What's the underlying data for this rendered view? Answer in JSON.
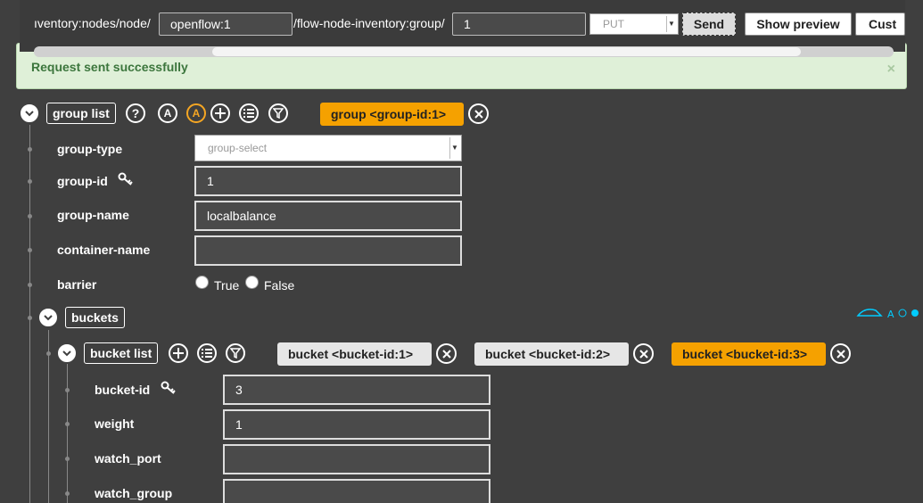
{
  "topbar": {
    "url_prefix": "ıventory:nodes/node/",
    "node_value": "openflow:1",
    "url_middle": "/flow-node-inventory:group/",
    "group_value": "1",
    "method": "PUT",
    "send_label": "Send",
    "preview_label": "Show preview",
    "custom_label": "Cust"
  },
  "alert": {
    "message": "Request sent successfully",
    "close": "×"
  },
  "group": {
    "list_label": "group list",
    "help_glyph": "?",
    "a_glyph": "A",
    "active_item": "group  <group-id:1>",
    "fields": {
      "group_type_label": "group-type",
      "group_type_value": "group-select",
      "group_id_label": "group-id",
      "group_id_value": "1",
      "group_name_label": "group-name",
      "group_name_value": "localbalance",
      "container_name_label": "container-name",
      "container_name_value": "",
      "barrier_label": "barrier",
      "true_label": "True",
      "false_label": "False"
    }
  },
  "buckets": {
    "label": "buckets",
    "list_label": "bucket list",
    "items": [
      "bucket  <bucket-id:1>",
      "bucket  <bucket-id:2>",
      "bucket  <bucket-id:3>"
    ],
    "fields": {
      "bucket_id_label": "bucket-id",
      "bucket_id_value": "3",
      "weight_label": "weight",
      "weight_value": "1",
      "watch_port_label": "watch_port",
      "watch_port_value": "",
      "watch_group_label": "watch_group",
      "watch_group_value": ""
    }
  },
  "colors": {
    "accent": "#f5a100",
    "background": "#3f3f3f"
  }
}
